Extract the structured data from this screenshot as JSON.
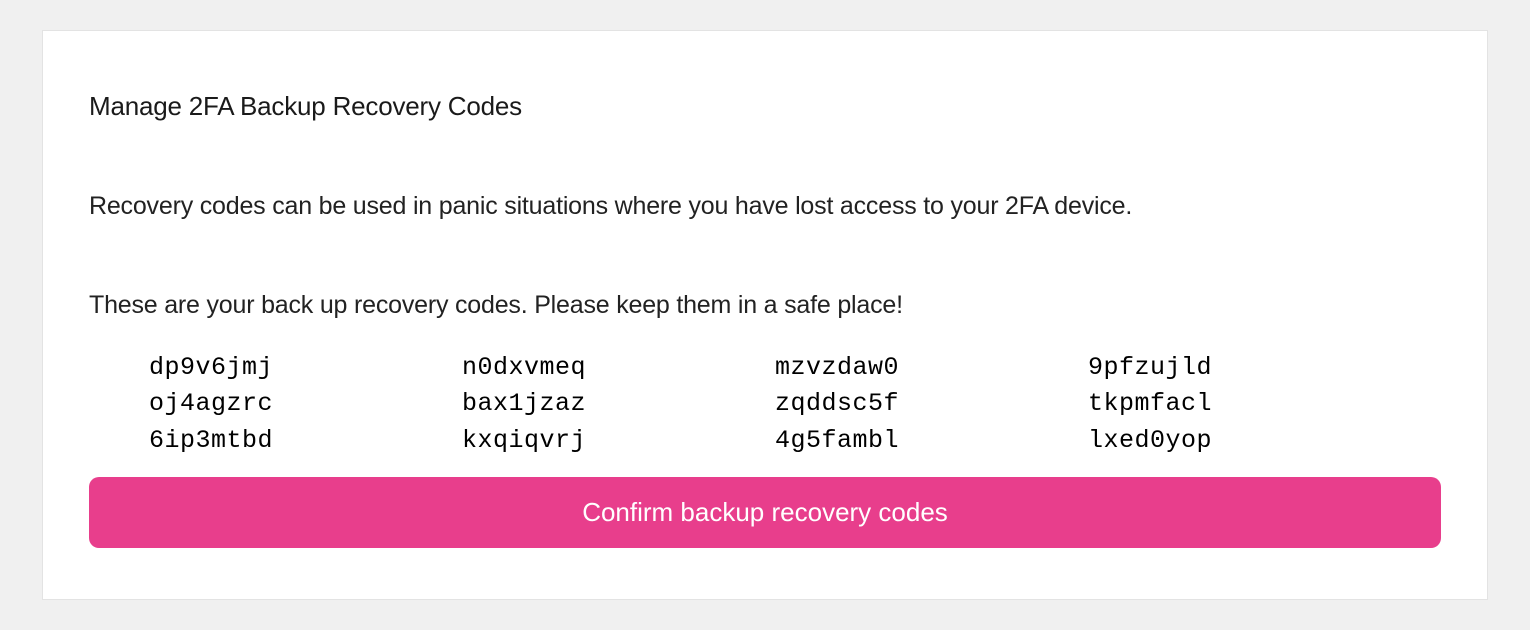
{
  "header": {
    "title": "Manage 2FA Backup Recovery Codes"
  },
  "body": {
    "description": "Recovery codes can be used in panic situations where you have lost access to your 2FA device.",
    "instruction": "These are your back up recovery codes. Please keep them in a safe place!"
  },
  "codes": {
    "col1": {
      "r1": "dp9v6jmj",
      "r2": "oj4agzrc",
      "r3": "6ip3mtbd"
    },
    "col2": {
      "r1": "n0dxvmeq",
      "r2": "bax1jzaz",
      "r3": "kxqiqvrj"
    },
    "col3": {
      "r1": "mzvzdaw0",
      "r2": "zqddsc5f",
      "r3": "4g5fambl"
    },
    "col4": {
      "r1": "9pfzujld",
      "r2": "tkpmfacl",
      "r3": "lxed0yop"
    }
  },
  "actions": {
    "confirm_label": "Confirm backup recovery codes"
  }
}
